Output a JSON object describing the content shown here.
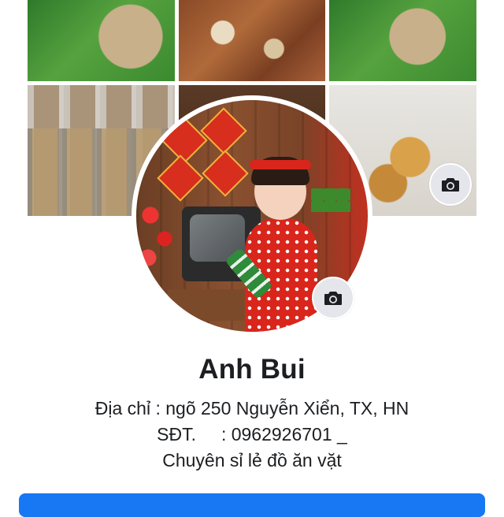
{
  "profile": {
    "name": "Anh Bui",
    "bio": {
      "line1": "Địa chỉ : ngõ 250 Nguyễn Xiển, TX, HN",
      "line2": "SĐT.     : 0962926701 _",
      "line3": "Chuyên sỉ lẻ đồ ăn vặt"
    }
  },
  "icons": {
    "cover_camera": "camera-icon",
    "profile_camera": "camera-icon"
  },
  "colors": {
    "accent": "#1877f2",
    "icon_button_bg": "#e4e6eb",
    "text": "#1c1e21"
  }
}
